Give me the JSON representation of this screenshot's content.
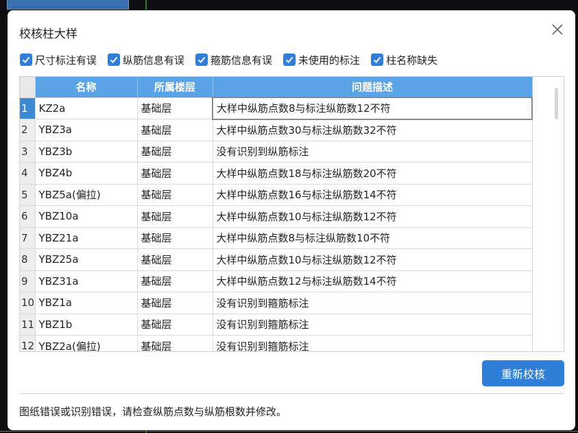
{
  "dialog": {
    "title": "校核柱大样",
    "close_icon": "close-icon"
  },
  "filters": [
    {
      "label": "尺寸标注有误",
      "checked": true
    },
    {
      "label": "纵筋信息有误",
      "checked": true
    },
    {
      "label": "箍筋信息有误",
      "checked": true
    },
    {
      "label": "未使用的标注",
      "checked": true
    },
    {
      "label": "柱名称缺失",
      "checked": true
    }
  ],
  "table": {
    "columns": [
      "名称",
      "所属楼层",
      "问题描述"
    ],
    "rows": [
      {
        "num": "1",
        "name": "KZ2a",
        "floor": "基础层",
        "desc": "大样中纵筋点数8与标注纵筋数12不符"
      },
      {
        "num": "2",
        "name": "YBZ3a",
        "floor": "基础层",
        "desc": "大样中纵筋点数30与标注纵筋数32不符"
      },
      {
        "num": "3",
        "name": "YBZ3b",
        "floor": "基础层",
        "desc": "没有识别到纵筋标注"
      },
      {
        "num": "4",
        "name": "YBZ4b",
        "floor": "基础层",
        "desc": "大样中纵筋点数18与标注纵筋数20不符"
      },
      {
        "num": "5",
        "name": "YBZ5a(偏拉)",
        "floor": "基础层",
        "desc": "大样中纵筋点数16与标注纵筋数14不符"
      },
      {
        "num": "6",
        "name": "YBZ10a",
        "floor": "基础层",
        "desc": "大样中纵筋点数10与标注纵筋数12不符"
      },
      {
        "num": "7",
        "name": "YBZ21a",
        "floor": "基础层",
        "desc": "大样中纵筋点数8与标注纵筋数10不符"
      },
      {
        "num": "8",
        "name": "YBZ25a",
        "floor": "基础层",
        "desc": "大样中纵筋点数10与标注纵筋数12不符"
      },
      {
        "num": "9",
        "name": "YBZ31a",
        "floor": "基础层",
        "desc": "大样中纵筋点数12与标注纵筋数14不符"
      },
      {
        "num": "10",
        "name": "YBZ1a",
        "floor": "基础层",
        "desc": "没有识别到箍筋标注"
      },
      {
        "num": "11",
        "name": "YBZ1b",
        "floor": "基础层",
        "desc": "没有识别到箍筋标注"
      },
      {
        "num": "12",
        "name": "YBZ2a(偏拉)",
        "floor": "基础层",
        "desc": "没有识别到箍筋标注"
      }
    ],
    "selected_row": "1"
  },
  "actions": {
    "recheck_label": "重新校核"
  },
  "hint": "图纸错误或识别错误，请检查纵筋点数与纵筋根数并修改。",
  "colors": {
    "accent": "#2f7fd8",
    "header": "#5aa3e6"
  }
}
